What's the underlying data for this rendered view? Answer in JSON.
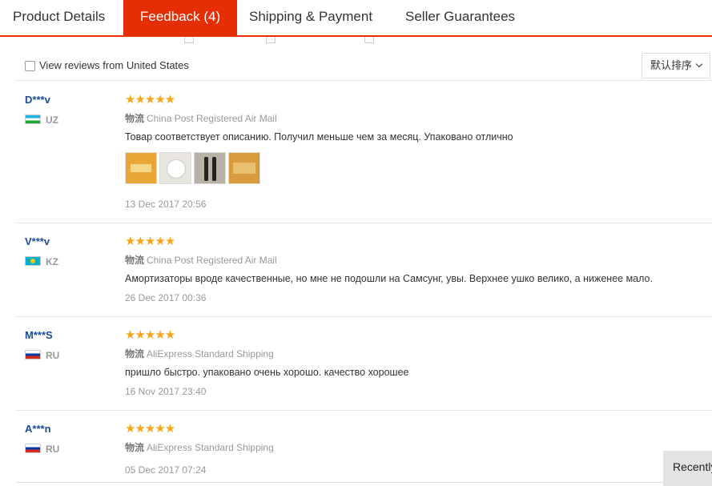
{
  "tabs": [
    {
      "label": "Product Details"
    },
    {
      "label": "Feedback (4)",
      "active": true
    },
    {
      "label": "Shipping & Payment"
    },
    {
      "label": "Seller Guarantees"
    }
  ],
  "toolbar": {
    "us_filter_label": "View reviews from United States",
    "sort_label": "默认排序"
  },
  "shipping_prefix": "物流",
  "reviews": [
    {
      "user": "D***v",
      "country": "UZ",
      "rating": 5,
      "shipping": "China Post Registered Air Mail",
      "text": "Товар соответствует описанию. Получил меньше чем за месяц. Упаковано отлично",
      "photos": 4,
      "date": "13 Dec 2017 20:56"
    },
    {
      "user": "V***v",
      "country": "KZ",
      "rating": 5,
      "shipping": "China Post Registered Air Mail",
      "text": "Амортизаторы вроде качественные, но мне не подошли на Самсунг, увы. Верхнее ушко велико, а ниженее мало.",
      "date": "26 Dec 2017 00:36"
    },
    {
      "user": "M***S",
      "country": "RU",
      "rating": 5,
      "shipping": "AliExpress Standard Shipping",
      "text": "пришло быстро. упаковано очень хорошо. качество хорошее",
      "date": "16 Nov 2017 23:40"
    },
    {
      "user": "A***n",
      "country": "RU",
      "rating": 5,
      "shipping": "AliExpress Standard Shipping",
      "text": "",
      "date": "05 Dec 2017 07:24"
    }
  ],
  "recent_button": "Recently Viewed",
  "colors": {
    "accent": "#e62e04",
    "star": "#f7a61c",
    "username": "#1c4b95"
  }
}
